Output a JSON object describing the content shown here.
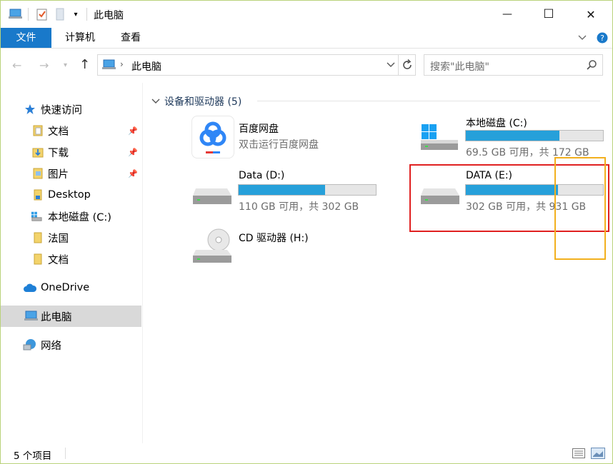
{
  "window": {
    "title": "此电脑",
    "minimize_glyph": "—",
    "maximize_glyph": "☐",
    "close_glyph": "✕"
  },
  "ribbon": {
    "tabs": [
      {
        "label": "文件",
        "active": true
      },
      {
        "label": "计算机",
        "active": false
      },
      {
        "label": "查看",
        "active": false
      }
    ]
  },
  "address": {
    "path_label": "此电脑",
    "search_placeholder": "搜索\"此电脑\""
  },
  "sidebar": {
    "items": [
      {
        "label": "快速访问",
        "icon": "star-icon",
        "pinned": false,
        "selected": false
      },
      {
        "label": "文档",
        "icon": "documents-folder-icon",
        "pinned": true,
        "selected": false
      },
      {
        "label": "下载",
        "icon": "downloads-folder-icon",
        "pinned": true,
        "selected": false
      },
      {
        "label": "图片",
        "icon": "pictures-folder-icon",
        "pinned": true,
        "selected": false
      },
      {
        "label": "Desktop",
        "icon": "folder-icon",
        "pinned": false,
        "selected": false
      },
      {
        "label": "本地磁盘 (C:)",
        "icon": "windows-drive-icon",
        "pinned": false,
        "selected": false
      },
      {
        "label": "法国",
        "icon": "folder-icon",
        "pinned": false,
        "selected": false
      },
      {
        "label": "文档",
        "icon": "folder-icon",
        "pinned": false,
        "selected": false
      },
      {
        "label": "OneDrive",
        "icon": "cloud-icon",
        "pinned": false,
        "selected": false
      },
      {
        "label": "此电脑",
        "icon": "computer-icon",
        "pinned": false,
        "selected": true
      },
      {
        "label": "网络",
        "icon": "network-icon",
        "pinned": false,
        "selected": false
      }
    ]
  },
  "main": {
    "group_header": "设备和驱动器 (5)",
    "tiles": [
      {
        "name": "百度网盘",
        "sub": "双击运行百度网盘",
        "icon": "baidu-netdisk-icon"
      },
      {
        "name": "本地磁盘 (C:)",
        "sub": "69.5 GB 可用，共 172 GB",
        "icon": "windows-drive-icon",
        "used_fraction": 0.68
      },
      {
        "name": "Data (D:)",
        "sub": "110 GB 可用，共 302 GB",
        "icon": "hard-drive-icon",
        "used_fraction": 0.63
      },
      {
        "name": "DATA (E:)",
        "sub": "302 GB 可用，共 931 GB",
        "icon": "hard-drive-icon",
        "used_fraction": 0.67
      },
      {
        "name": "CD 驱动器 (H:)",
        "sub": "",
        "icon": "cd-drive-icon"
      }
    ]
  },
  "status": {
    "count_text": "5 个项目"
  },
  "colors": {
    "accent": "#1979ca",
    "bar_fill": "#26a0da",
    "highlight_red": "#e02020",
    "highlight_yellow": "#f2b01e"
  }
}
